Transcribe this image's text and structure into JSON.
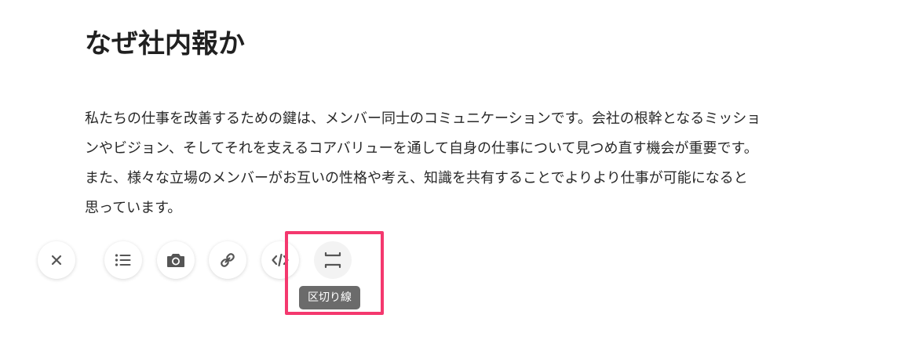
{
  "article": {
    "title": "なぜ社内報か",
    "body_lines": [
      "私たちの仕事を改善するための鍵は、メンバー同士のコミュニケーションです。会社の根幹となるミッショ",
      "ンやビジョン、そしてそれを支えるコアバリューを通して自身の仕事について見つめ直す機会が重要です。",
      "また、様々な立場のメンバーがお互いの性格や考え、知識を共有することでよりより仕事が可能になると",
      "思っています。"
    ]
  },
  "toolbar": {
    "buttons": [
      {
        "name": "close",
        "icon": "close-icon"
      },
      {
        "name": "list",
        "icon": "list-icon"
      },
      {
        "name": "image",
        "icon": "camera-icon"
      },
      {
        "name": "link",
        "icon": "link-icon"
      },
      {
        "name": "embed",
        "icon": "code-icon"
      },
      {
        "name": "divider",
        "icon": "horizontal-rule-icon",
        "hovered": true
      }
    ],
    "tooltip": "区切り線"
  },
  "colors": {
    "highlight": "#f4386e",
    "tooltip_bg": "#6b6b6b",
    "icon": "#555555"
  }
}
